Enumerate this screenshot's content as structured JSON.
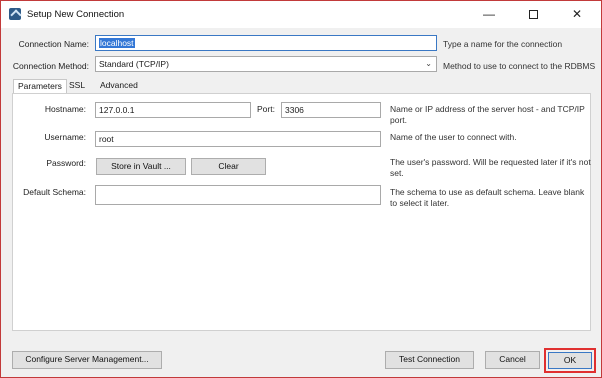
{
  "window": {
    "title": "Setup New Connection",
    "minimize_glyph": "—",
    "close_glyph": "✕",
    "icon": "mysql-workbench-icon"
  },
  "connection_name": {
    "label": "Connection Name:",
    "value": "localhost",
    "hint": "Type a name for the connection"
  },
  "connection_method": {
    "label": "Connection Method:",
    "value": "Standard (TCP/IP)",
    "hint": "Method to use to connect to the RDBMS"
  },
  "tabs": [
    "Parameters",
    "SSL",
    "Advanced"
  ],
  "parameters": {
    "hostname": {
      "label": "Hostname:",
      "value": "127.0.0.1",
      "hint": "Name or IP address of the server host - and TCP/IP port."
    },
    "port": {
      "label": "Port:",
      "value": "3306"
    },
    "username": {
      "label": "Username:",
      "value": "root",
      "hint": "Name of the user to connect with."
    },
    "password": {
      "label": "Password:",
      "store_button": "Store in Vault ...",
      "clear_button": "Clear",
      "hint": "The user's password. Will be requested later if it's not set."
    },
    "default_schema": {
      "label": "Default Schema:",
      "value": "",
      "hint": "The schema to use as default schema. Leave blank to select it later."
    }
  },
  "footer": {
    "configure_button": "Configure Server Management...",
    "test_button": "Test Connection",
    "cancel_button": "Cancel",
    "ok_button": "OK"
  },
  "colors": {
    "highlight": "#e03030",
    "selection": "#3377d6"
  }
}
